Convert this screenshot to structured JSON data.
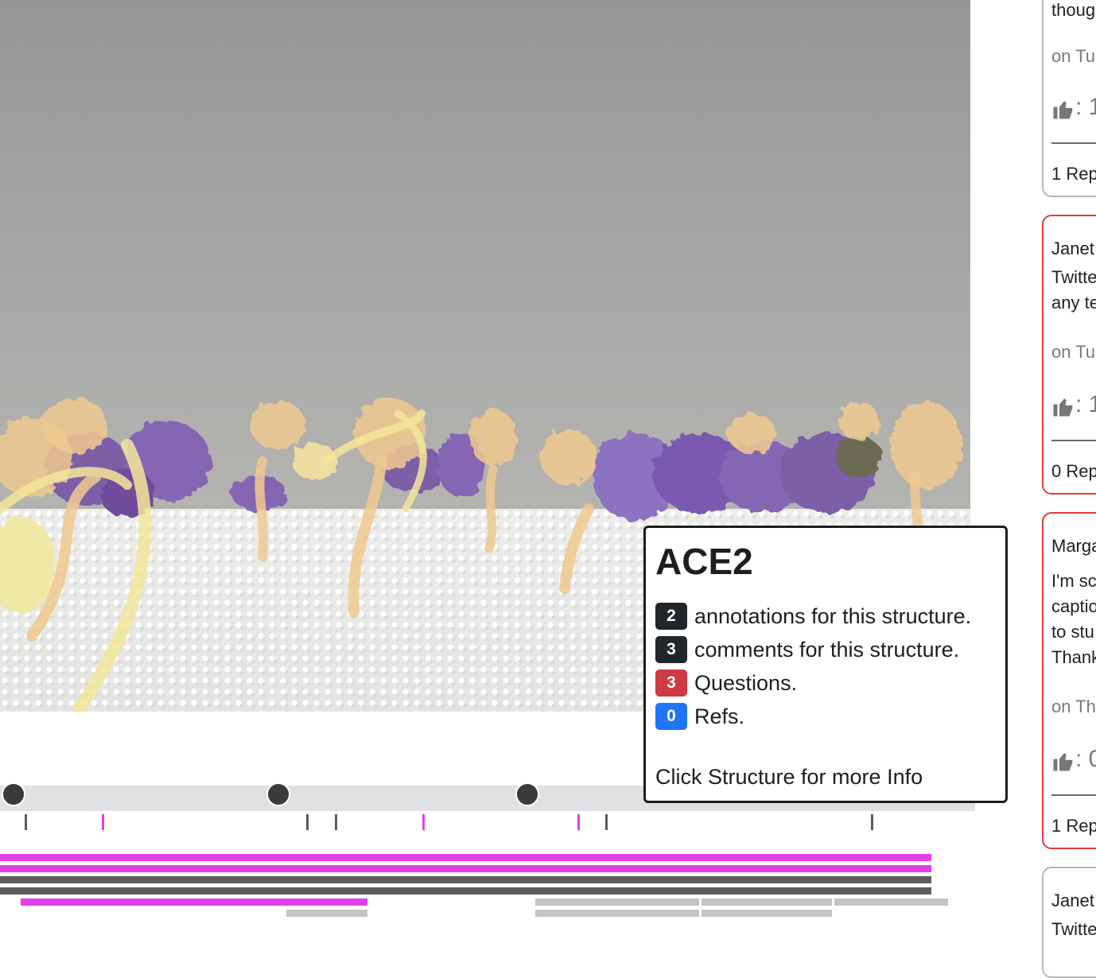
{
  "popup": {
    "title": "ACE2",
    "rows": [
      {
        "count": "2",
        "text": "annotations for this structure.",
        "color": "#22262b"
      },
      {
        "count": "3",
        "text": "comments for this structure.",
        "color": "#22262b"
      },
      {
        "count": "3",
        "text": "Questions.",
        "color": "#d03a43"
      },
      {
        "count": "0",
        "text": "Refs.",
        "color": "#2075f5"
      }
    ],
    "hint": "Click Structure for more Info"
  },
  "comments": [
    {
      "text_lines": [
        "thoug"
      ],
      "date": "on Tu",
      "likes": ": 1",
      "replies": "1 Rep",
      "border": "gray"
    },
    {
      "author": "Janet",
      "text_lines": [
        "Twitte",
        "any te"
      ],
      "date": "on Tu",
      "likes": ": 1",
      "replies": "0 Rep",
      "border": "red"
    },
    {
      "author": "Marga",
      "text_lines": [
        "I'm sc",
        "captio",
        "to stu",
        "Thank"
      ],
      "date": "on Th",
      "likes": ": 0",
      "replies": "1 Rep",
      "border": "red"
    },
    {
      "author": "Janet",
      "text_lines": [
        "Twitte"
      ],
      "border": "gray"
    }
  ],
  "colors": {
    "annotation": "#e23ee8",
    "comment": "#5c5c5c",
    "reference": "#c4c4c4",
    "question": "#de3b3b"
  }
}
